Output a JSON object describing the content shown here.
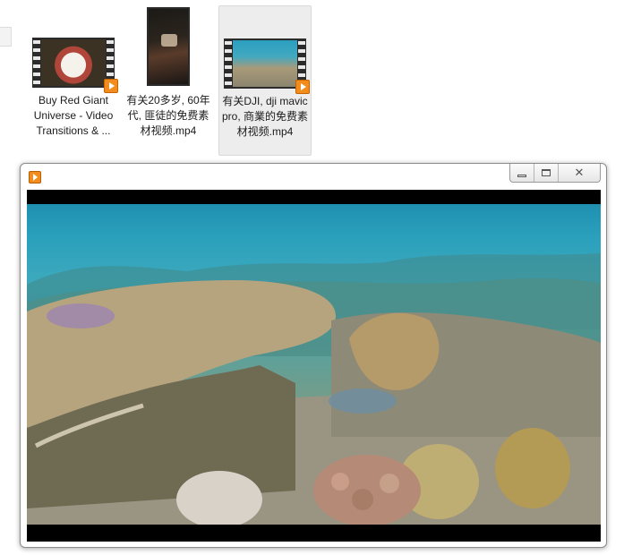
{
  "files": [
    {
      "name": "Buy Red Giant Universe - Video Transitions & ...",
      "kind": "video-file",
      "selected": false
    },
    {
      "name": "有关20多岁, 60年代, 匪徒的免费素材视频.mp4",
      "kind": "video-file",
      "selected": false
    },
    {
      "name": "有关DJI, dji mavic pro, 商業的免费素材视频.mp4",
      "kind": "video-file",
      "selected": true
    }
  ],
  "player": {
    "title": "",
    "controls": {
      "minimize": "",
      "maximize": "",
      "close": "✕"
    },
    "video_scene": "underwater coral reef"
  },
  "colors": {
    "accent_play": "#f28c1c",
    "selection_bg": "#ededed",
    "letterbox": "#000000"
  },
  "icons": [
    "film-thumbnail-icon",
    "play-badge-icon",
    "media-player-app-icon",
    "minimize-icon",
    "maximize-icon",
    "close-icon"
  ]
}
